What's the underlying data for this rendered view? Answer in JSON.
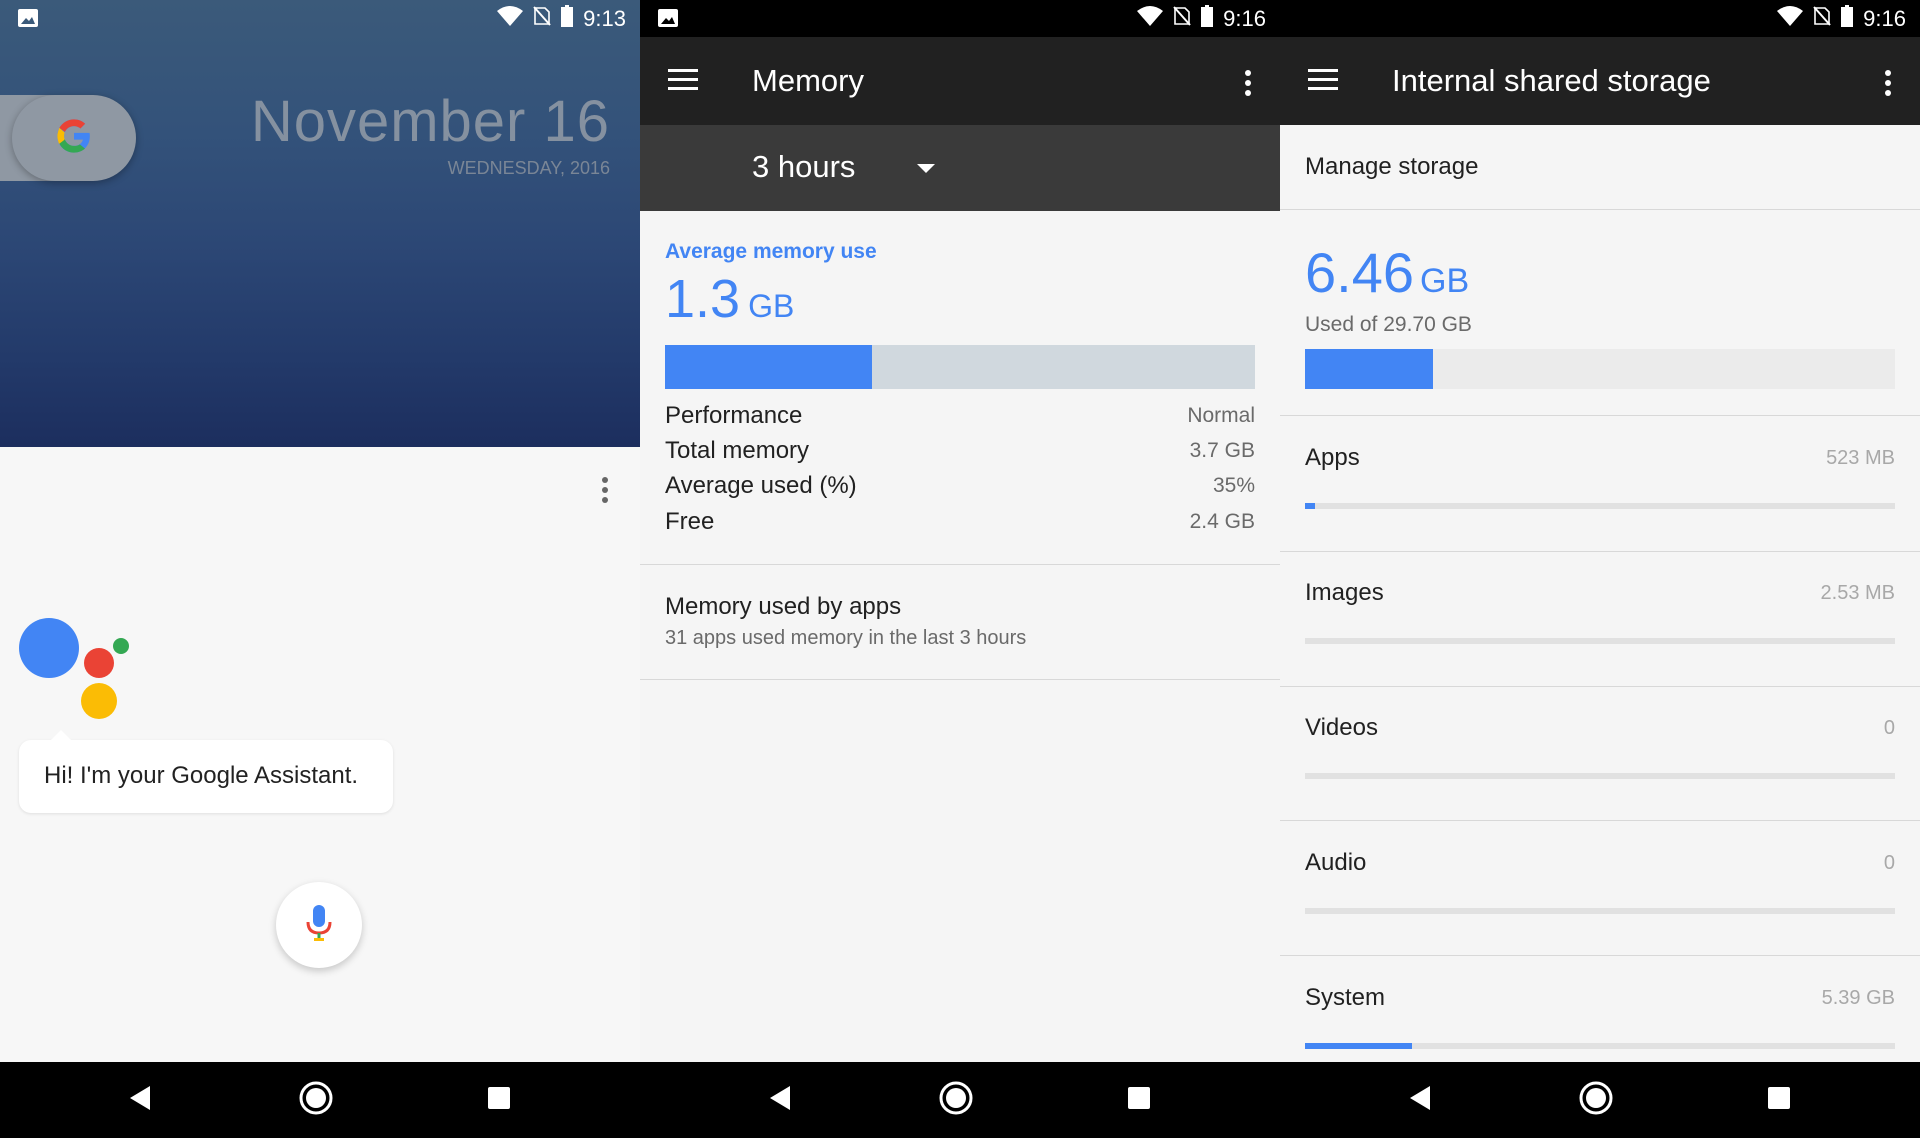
{
  "panel1": {
    "time": "9:13",
    "date": "November 16",
    "weekday": "WEDNESDAY, 2016",
    "assistant_greeting": "Hi! I'm your Google Assistant."
  },
  "panel2": {
    "time": "9:16",
    "title": "Memory",
    "period": "3 hours",
    "section_title": "Average memory use",
    "avg_value": "1.3",
    "avg_unit": "GB",
    "usage_fraction": 0.35,
    "stats": [
      {
        "label": "Performance",
        "value": "Normal"
      },
      {
        "label": "Total memory",
        "value": "3.7 GB"
      },
      {
        "label": "Average used (%)",
        "value": "35%"
      },
      {
        "label": "Free",
        "value": "2.4 GB"
      }
    ],
    "apps_title": "Memory used by apps",
    "apps_subtitle": "31 apps used memory in the last 3 hours"
  },
  "panel3": {
    "time": "9:16",
    "title": "Internal shared storage",
    "manage": "Manage storage",
    "used_value": "6.46",
    "used_unit": "GB",
    "used_of": "Used of 29.70 GB",
    "used_fraction": 0.2175,
    "categories": [
      {
        "label": "Apps",
        "size": "523 MB",
        "fraction": 0.0176
      },
      {
        "label": "Images",
        "size": "2.53 MB",
        "fraction": 0.0
      },
      {
        "label": "Videos",
        "size": "0",
        "fraction": 0.0
      },
      {
        "label": "Audio",
        "size": "0",
        "fraction": 0.0
      },
      {
        "label": "System",
        "size": "5.39 GB",
        "fraction": 0.1815
      }
    ]
  },
  "colors": {
    "accent": "#4285f4",
    "appbar": "#212121",
    "google_blue": "#4285f4",
    "google_red": "#ea4335",
    "google_yellow": "#fbbc05",
    "google_green": "#34a853"
  }
}
